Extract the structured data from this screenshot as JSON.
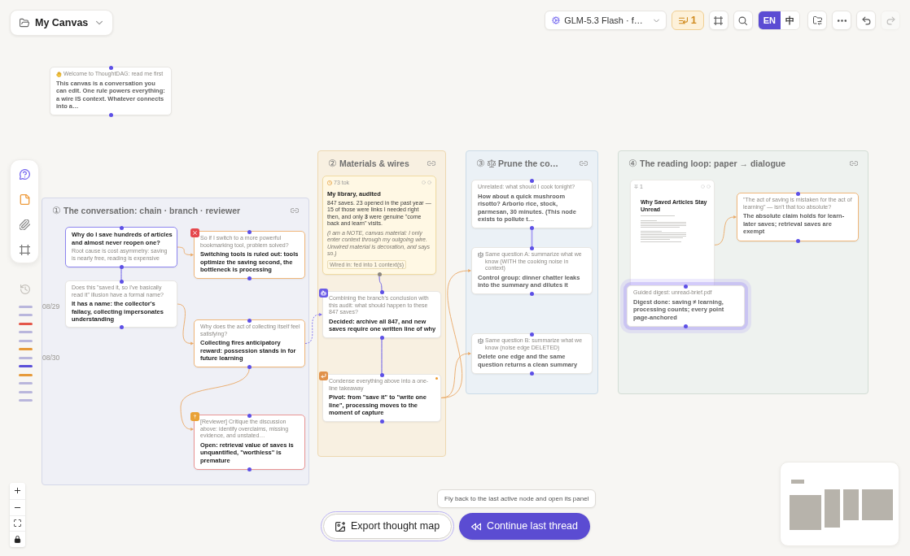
{
  "canvas_menu": {
    "title": "My Canvas"
  },
  "toolbar": [
    {
      "kind": "model",
      "label": "GLM-5.3 Flash · f…",
      "disabled": false
    },
    {
      "kind": "queue",
      "label": "1",
      "disabled": false
    },
    {
      "kind": "frame",
      "disabled": false
    },
    {
      "kind": "search",
      "disabled": false
    },
    {
      "kind": "language",
      "options": [
        {
          "label": "EN",
          "selected": true
        },
        {
          "label": "中",
          "selected": false
        }
      ],
      "disabled": false
    },
    {
      "kind": "folder",
      "disabled": false
    },
    {
      "kind": "more",
      "disabled": false
    },
    {
      "kind": "undo",
      "disabled": false
    },
    {
      "kind": "redo",
      "disabled": true
    }
  ],
  "tool_panel": [
    {
      "kind": "ask"
    },
    {
      "kind": "note"
    },
    {
      "kind": "attach"
    },
    {
      "kind": "frame"
    }
  ],
  "history": {
    "marks": [
      {
        "color": "#b9b6dc",
        "date": "08/29"
      },
      {
        "color": "#b9b6dc"
      },
      {
        "color": "#e4574a"
      },
      {
        "color": "#b9b6dc"
      },
      {
        "color": "#b9b6dc"
      },
      {
        "color": "#e69a3a"
      },
      {
        "color": "#b9b6dc",
        "date": "08/30"
      },
      {
        "color": "#5b50d8"
      },
      {
        "color": "#e69a3a"
      },
      {
        "color": "#b9b6dc"
      },
      {
        "color": "#b9b6dc"
      },
      {
        "color": "#b9b6dc"
      }
    ]
  },
  "canvas": {
    "notes": [
      {
        "kind": "welcome",
        "label": "Welcome to ThoughtDAG: read me first",
        "text": "This canvas is a conversation you can edit. One rule powers everything: a wire IS context. Whatever connects into a…",
        "dimmed": true,
        "highlighted": false,
        "unseen": false
      }
    ],
    "groups": [
      {
        "kind": "plain",
        "number": "①",
        "title": "The conversation: chain · branch · reviewer",
        "color": "#eff0f6",
        "nodes": [
          {
            "kind": "question",
            "text": "Why do I save hundreds of articles and almost never reopen one?",
            "detail": "Root cause is cost asymmetry: saving is nearly free, reading is expensive",
            "color": "#8d85ef",
            "dimmed": false,
            "highlighted": false,
            "unseen": false
          },
          {
            "kind": "answer",
            "label": "Does this \"saved it, so I've basically read it\" illusion have a formal name?",
            "text": "It has a name: the collector's fallacy, collecting impersonates understanding",
            "dimmed": false,
            "highlighted": false,
            "unseen": false
          },
          {
            "kind": "rejected",
            "label": "So if I switch to a more powerful bookmarking tool, problem solved?",
            "text": "Switching tools is ruled out: tools optimize the saving second, the bottleneck is processing",
            "color": "#efb67a",
            "dimmed": false,
            "highlighted": false,
            "unseen": false
          },
          {
            "kind": "answer",
            "label": "Why does the act of collecting itself feel satisfying?",
            "text": "Collecting fires anticipatory reward: possession stands in for future learning",
            "color": "#efb67a",
            "dimmed": false,
            "highlighted": false,
            "unseen": false
          },
          {
            "kind": "review",
            "label": "[Reviewer] Critique the discussion above: identify overclaims, missing evidence, and unstated…",
            "text": "Open: retrieval value of saves is unquantified, \"worthless\" is premature",
            "color": "#e99494",
            "dimmed": false,
            "highlighted": false,
            "unseen": false
          }
        ]
      },
      {
        "kind": "plain",
        "number": "②",
        "title": "Materials & wires",
        "color": "#f8f0e1",
        "nodes": [
          {
            "kind": "note",
            "meta": "73 tok",
            "title": "My library, audited",
            "text": "847 saves. 23 opened in the past year — 15 of those were links I needed right then, and only **3** were genuine \"come back and learn\" visits.",
            "aside": "(I am a NOTE, canvas material: I only enter context through my outgoing wire. Unwired material is decoration, and says so.)",
            "footer": "Wired in: fed into 1 context(s)",
            "dimmed": false,
            "highlighted": false,
            "unseen": false
          },
          {
            "kind": "merge",
            "label": "Combining the branch's conclusion with this audit: what should happen to these 847 saves?",
            "text": "Decided: archive all 847, and new saves require one written line of why",
            "dimmed": false,
            "highlighted": false,
            "unseen": false
          },
          {
            "kind": "condense",
            "label": "Condense everything above into a one-line takeaway",
            "text": "Pivot: from \"save it\" to \"write one line\", processing moves to the moment of capture",
            "dimmed": false,
            "highlighted": false,
            "unseen": true
          }
        ]
      },
      {
        "kind": "experiment",
        "number": "③",
        "title": "Prune the co…",
        "color": "#ebf1f6",
        "nodes": [
          {
            "kind": "answer",
            "label": "Unrelated: what should I cook tonight?",
            "text": "How about a quick mushroom risotto? Arborio rice, stock, parmesan, 30 minutes. (This node exists to pollute t…",
            "dimmed": true,
            "highlighted": false,
            "unseen": false
          },
          {
            "kind": "experiment",
            "label": "Same question A: summarize what we know (WITH the cooking noise in context)",
            "text": "Control group: dinner chatter leaks into the summary and dilutes it",
            "dimmed": true,
            "highlighted": false,
            "unseen": false
          },
          {
            "kind": "experiment",
            "label": "Same question B: summarize what we know (noise edge DELETED)",
            "text": "Delete one edge and the same question returns a clean summary",
            "dimmed": true,
            "highlighted": false,
            "unseen": false
          }
        ]
      },
      {
        "kind": "plain",
        "number": "④",
        "title": "The reading loop: paper → dialogue",
        "color": "#eef2ef",
        "nodes": [
          {
            "kind": "document",
            "page": "1",
            "heading": "Why Saved Articles Stay Unread",
            "dimmed": false,
            "highlighted": false,
            "unseen": false
          },
          {
            "kind": "answer",
            "label": "\"The act of saving is mistaken for the act of learning\" — isn't that too absolute?",
            "text": "The absolute claim holds for learn-later saves; retrieval saves are exempt",
            "color": "#efb67a",
            "dimmed": true,
            "highlighted": false,
            "unseen": false
          },
          {
            "kind": "answer",
            "label": "Guided digest: unread-brief.pdf",
            "text": "Digest done: saving ≠ learning, processing counts; every point page-anchored",
            "dimmed": true,
            "highlighted": true,
            "unseen": false
          }
        ]
      }
    ]
  },
  "zoom_controls": [
    {
      "kind": "zoom_in"
    },
    {
      "kind": "zoom_out"
    },
    {
      "kind": "fit"
    },
    {
      "kind": "lock"
    }
  ],
  "actions": [
    {
      "kind": "export",
      "label": "Export thought map"
    },
    {
      "kind": "continue",
      "label": "Continue last thread",
      "tooltip": "Fly back to the last active node and open its panel"
    }
  ]
}
